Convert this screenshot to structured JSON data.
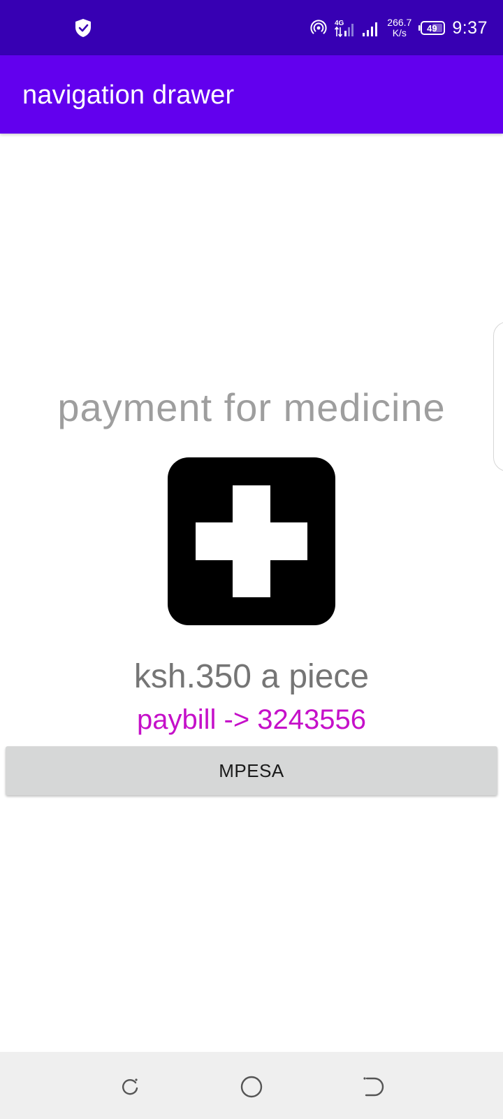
{
  "status_bar": {
    "network_type": "4G",
    "net_speed_value": "266.7",
    "net_speed_unit": "K/s",
    "battery_level": "49",
    "time": "9:37",
    "icons": [
      "shield-check-icon",
      "hotspot-icon",
      "signal-4g-icon",
      "signal-bars-icon",
      "battery-icon"
    ]
  },
  "app_bar": {
    "title": "navigation drawer"
  },
  "content": {
    "headline": "payment for medicine",
    "image_icon": "medical-cross-icon",
    "price": "ksh.350 a piece",
    "paybill": "paybill -> 3243556",
    "button_label": "MPESA"
  },
  "nav_bar": {
    "icons": [
      "recent-apps-icon",
      "home-icon",
      "back-icon"
    ]
  },
  "colors": {
    "status_bar": "#3700b3",
    "app_bar": "#6200ee",
    "headline": "#9e9e9e",
    "price": "#757575",
    "paybill": "#c510c9",
    "button": "#d6d7d7"
  }
}
